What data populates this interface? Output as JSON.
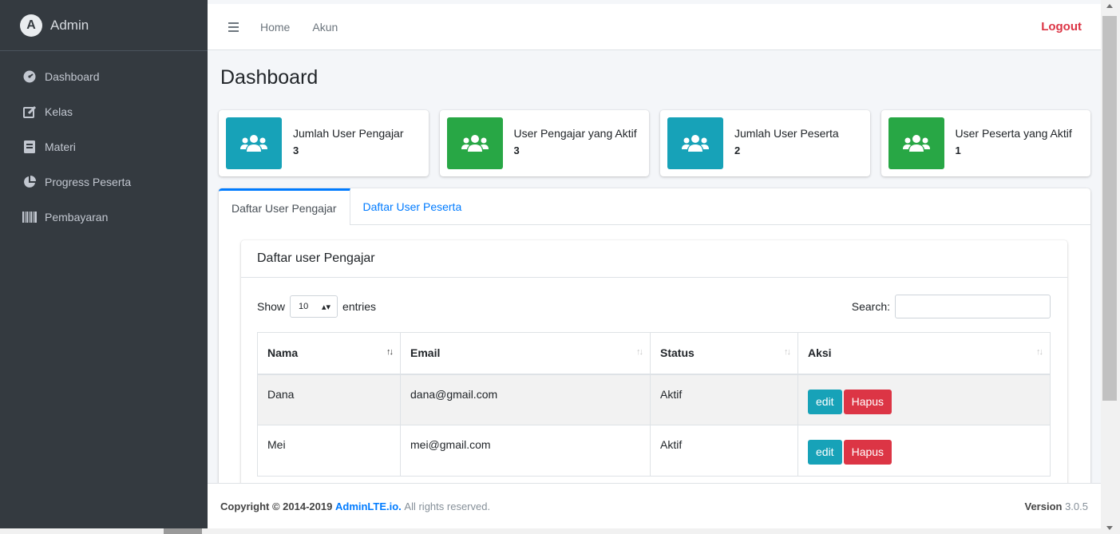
{
  "brand": {
    "name": "Admin",
    "logo_letter": "A"
  },
  "sidebar": {
    "items": [
      {
        "label": "Dashboard",
        "icon": "tachometer-icon"
      },
      {
        "label": "Kelas",
        "icon": "edit-icon"
      },
      {
        "label": "Materi",
        "icon": "book-icon"
      },
      {
        "label": "Progress Peserta",
        "icon": "pie-chart-icon"
      },
      {
        "label": "Pembayaran",
        "icon": "barcode-icon"
      }
    ]
  },
  "topbar": {
    "home": "Home",
    "akun": "Akun",
    "logout": "Logout"
  },
  "page": {
    "title": "Dashboard"
  },
  "info_boxes": [
    {
      "label": "Jumlah User Pengajar",
      "value": "3",
      "color": "#17a2b8"
    },
    {
      "label": "User Pengajar yang Aktif",
      "value": "3",
      "color": "#28a745"
    },
    {
      "label": "Jumlah User Peserta",
      "value": "2",
      "color": "#17a2b8"
    },
    {
      "label": "User Peserta yang Aktif",
      "value": "1",
      "color": "#28a745"
    }
  ],
  "tabs": [
    {
      "label": "Daftar User Pengajar",
      "active": true
    },
    {
      "label": "Daftar User Peserta",
      "active": false
    }
  ],
  "card": {
    "title": "Daftar user Pengajar",
    "show_label": "Show",
    "entries_label": "entries",
    "length_value": "10",
    "search_label": "Search:",
    "search_value": ""
  },
  "table": {
    "headers": [
      "Nama",
      "Email",
      "Status",
      "Aksi"
    ],
    "rows": [
      {
        "nama": "Dana",
        "email": "dana@gmail.com",
        "status": "Aktif",
        "edit": "edit",
        "hapus": "Hapus"
      },
      {
        "nama": "Mei",
        "email": "mei@gmail.com",
        "status": "Aktif",
        "edit": "edit",
        "hapus": "Hapus"
      }
    ]
  },
  "footer": {
    "copyright_prefix": "Copyright © 2014-2019",
    "link": "AdminLTE.io.",
    "suffix": "All rights reserved.",
    "version_label": "Version",
    "version": "3.0.5"
  },
  "colors": {
    "sidebar_bg": "#343a40",
    "primary": "#007bff",
    "danger": "#dc3545",
    "info": "#17a2b8",
    "success": "#28a745"
  }
}
